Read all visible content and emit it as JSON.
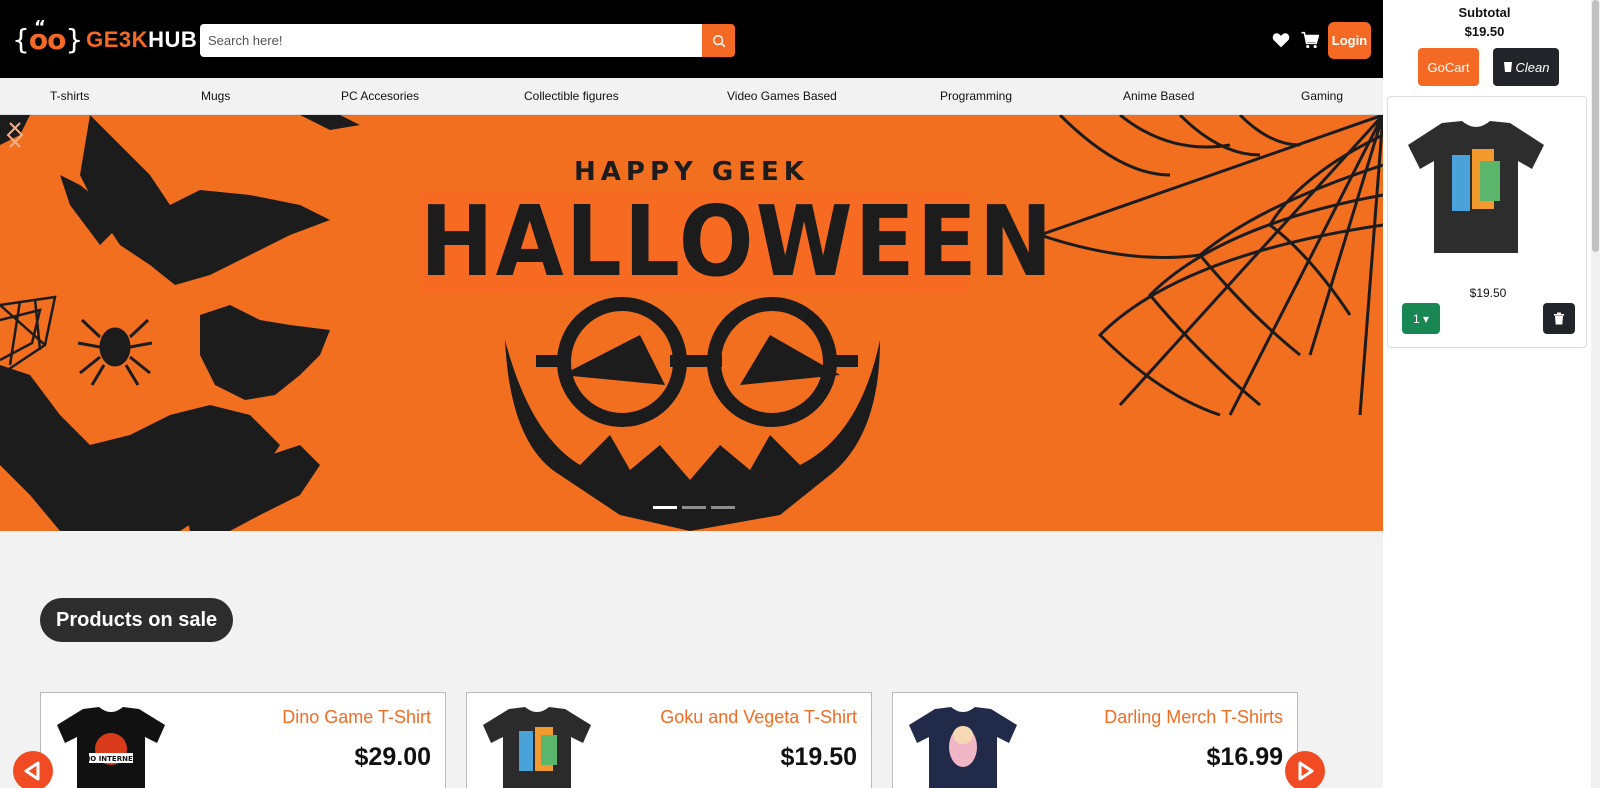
{
  "brand": {
    "logo_mark": "{oo}",
    "logo_quote": "“",
    "name_part1": "GE3K",
    "name_part2": "HUB",
    "accent": "#f46a24"
  },
  "search": {
    "placeholder": "Search here!",
    "value": ""
  },
  "header": {
    "login_label": "Login"
  },
  "nav": {
    "items": [
      {
        "label": "T-shirts"
      },
      {
        "label": "Mugs"
      },
      {
        "label": "PC Accesories"
      },
      {
        "label": "Collectible figures"
      },
      {
        "label": "Video Games Based"
      },
      {
        "label": "Programming"
      },
      {
        "label": "Anime Based"
      },
      {
        "label": "Gaming"
      }
    ]
  },
  "banner": {
    "line1": "HAPPY GEEK",
    "line2": "HALLOWEEN",
    "slide_count": 3,
    "active_slide": 1
  },
  "sale": {
    "title": "Products on sale",
    "products": [
      {
        "name": "Dino Game T-Shirt",
        "price": "$29.00",
        "shirt_color": "#111111",
        "graphic_text": "NO INTERNET"
      },
      {
        "name": "Goku and Vegeta T-Shirt",
        "price": "$19.50",
        "shirt_color": "#2b2b2b"
      },
      {
        "name": "Darling Merch T-Shirts",
        "price": "$16.99",
        "shirt_color": "#222a4a"
      }
    ]
  },
  "cart": {
    "subtotal_label": "Subtotal",
    "subtotal_value": "$19.50",
    "gocart_label": "GoCart",
    "clean_label": "Clean",
    "items": [
      {
        "price": "$19.50",
        "quantity": "1"
      }
    ]
  }
}
